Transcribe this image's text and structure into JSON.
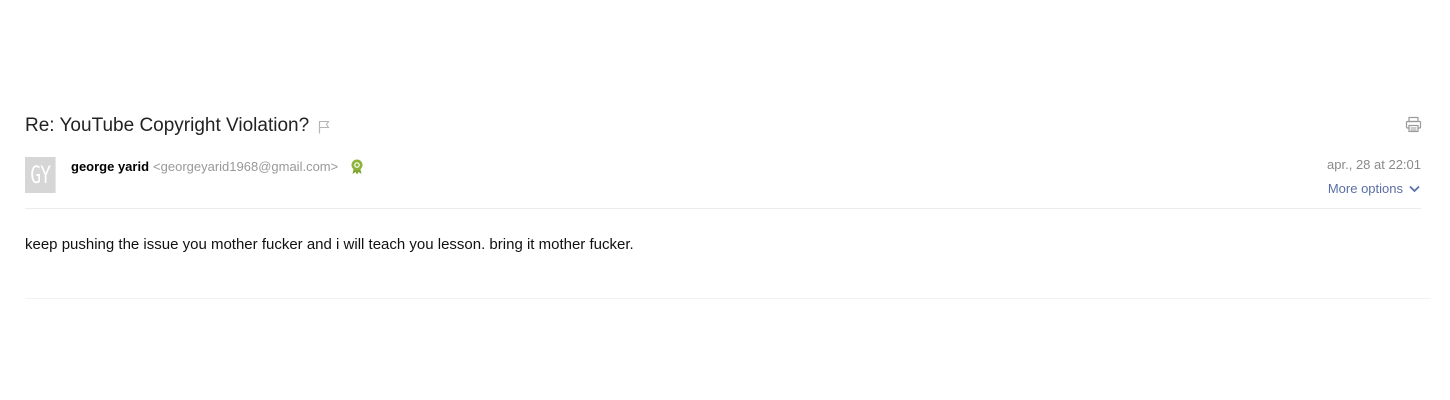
{
  "message": {
    "subject": "Re: YouTube Copyright Violation?",
    "icons": {
      "flag": "flag-icon",
      "print": "print-icon",
      "badge": "award-badge-icon",
      "chevron": "chevron-down-icon"
    },
    "sender": {
      "initials": "GY",
      "name": "george yarid",
      "email": "<georgeyarid1968@gmail.com>"
    },
    "date": "apr., 28 at 22:01",
    "more_options_label": "More options",
    "body": "keep pushing the issue you mother fucker and i will teach you lesson. bring it mother fucker."
  },
  "colors": {
    "link": "#5a6fa8",
    "muted": "#999999",
    "avatar_bg": "#d6d6d6",
    "badge": "#8db33a",
    "divider": "#ececec"
  }
}
